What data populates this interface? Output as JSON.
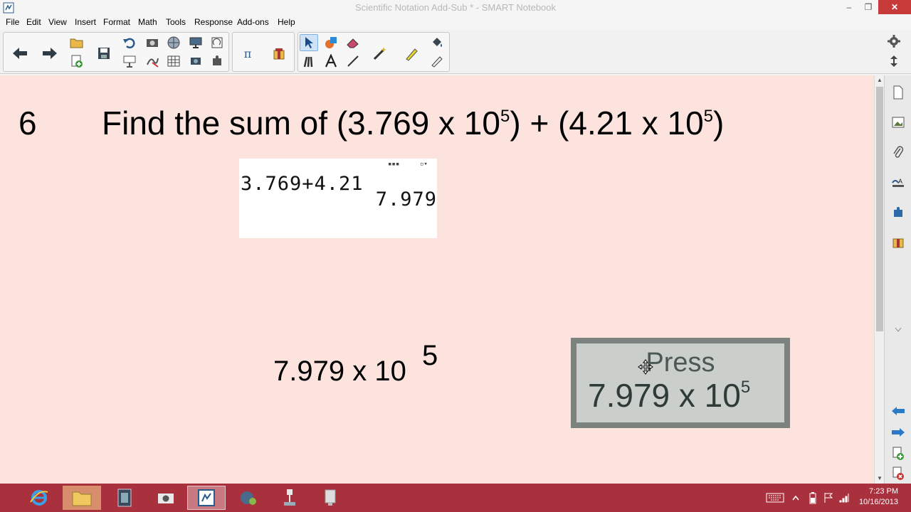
{
  "window": {
    "title": "Scientific Notation Add-Sub * - SMART Notebook",
    "minimize_glyph": "–",
    "maximize_glyph": "❐",
    "close_glyph": "✕"
  },
  "menu": {
    "items": [
      "File",
      "Edit",
      "View",
      "Insert",
      "Format",
      "Math",
      "Tools",
      "Response",
      "Add-ons",
      "Help"
    ]
  },
  "toolbar": {
    "math_tool_glyph": "π"
  },
  "page": {
    "question_number": "6",
    "question_prefix": "Find the sum of (3.769 x 10",
    "exp_1": "5",
    "question_middle": ") + (4.21 x 10",
    "exp_2": "5",
    "question_suffix": ")",
    "calculator": {
      "input": "3.769+4.21",
      "result": "7.979",
      "indicator_1": "▪▪▪",
      "indicator_2": "▫▾"
    },
    "answer_base": "7.979  x 10",
    "answer_exp": "5",
    "press_box": {
      "label": "Press",
      "value_base": "7.979 x 10",
      "value_exp": "5"
    }
  },
  "taskbar": {
    "time": "7:23 PM",
    "date": "10/16/2013"
  },
  "colors": {
    "canvas": "#fde3de",
    "taskbar": "#a9303d",
    "press_frame": "#7c837e",
    "press_fill": "#cbcfcc",
    "close_button": "#c73a3a"
  }
}
